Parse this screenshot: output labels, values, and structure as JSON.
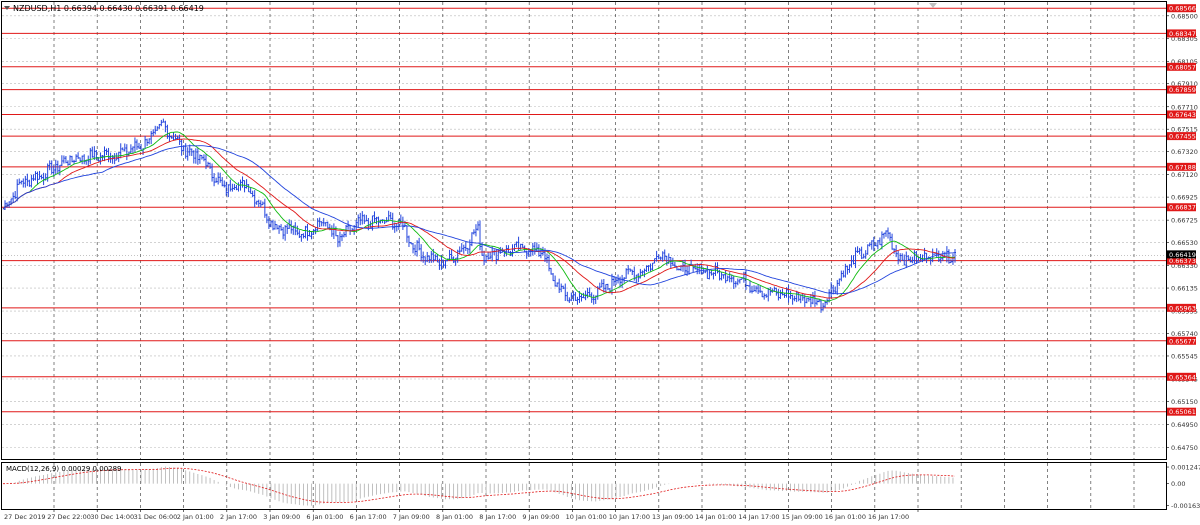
{
  "header": {
    "title": "NZDUSD,H1  0.66394 0.66430 0.66391 0.66419",
    "scroll_marker_icon": "triangle-down-icon"
  },
  "colors": {
    "candle": "#2244dd",
    "level_line": "#e01818",
    "level_label_bg": "#e01818",
    "ma_fast": "#11bb11",
    "ma_mid": "#e01818",
    "ma_slow": "#2244dd",
    "macd_hist": "#b0b0b0",
    "macd_signal": "#e01818",
    "grid": "#b8b8b8",
    "current_price_bg": "#000000"
  },
  "price_axis": {
    "ticks": [
      "0.68500",
      "0.68305",
      "0.68105",
      "0.67910",
      "0.67710",
      "0.67515",
      "0.67320",
      "0.67120",
      "0.66925",
      "0.66725",
      "0.66530",
      "0.66330",
      "0.66135",
      "0.65935",
      "0.65740",
      "0.65545",
      "0.65345",
      "0.65150",
      "0.64950",
      "0.64750"
    ],
    "levels": [
      "0.68566",
      "0.68347",
      "0.68057",
      "0.67859",
      "0.67643",
      "0.67455",
      "0.67188",
      "0.66837",
      "0.66373",
      "0.65963",
      "0.65677",
      "0.65364",
      "0.65061"
    ],
    "current_price": "0.66419"
  },
  "time_axis": {
    "labels": [
      "27 Dec 2019",
      "27 Dec 22:00",
      "30 Dec 14:00",
      "31 Dec 06:00",
      "2 Jan 01:00",
      "2 Jan 17:00",
      "3 Jan 09:00",
      "6 Jan 01:00",
      "6 Jan 17:00",
      "7 Jan 09:00",
      "8 Jan 01:00",
      "8 Jan 17:00",
      "9 Jan 09:00",
      "10 Jan 01:00",
      "10 Jan 17:00",
      "13 Jan 09:00",
      "14 Jan 01:00",
      "14 Jan 17:00",
      "15 Jan 09:00",
      "16 Jan 01:00",
      "16 Jan 17:00"
    ]
  },
  "macd": {
    "label": "MACD(12,26,9) 0.00029 0.00289",
    "ticks": [
      "0.001247",
      "0.00",
      "-0.001638"
    ]
  },
  "chart_data": {
    "type": "candlestick",
    "symbol": "NZDUSD",
    "timeframe": "H1",
    "ylim": [
      0.6465,
      0.6862
    ],
    "x": [
      "27 Dec 2019",
      "27 Dec 22:00",
      "30 Dec 14:00",
      "31 Dec 06:00",
      "2 Jan 01:00",
      "2 Jan 17:00",
      "3 Jan 09:00",
      "6 Jan 01:00",
      "6 Jan 17:00",
      "7 Jan 09:00",
      "8 Jan 01:00",
      "8 Jan 17:00",
      "9 Jan 09:00",
      "10 Jan 01:00",
      "10 Jan 17:00",
      "13 Jan 09:00",
      "14 Jan 01:00",
      "14 Jan 17:00",
      "15 Jan 09:00",
      "16 Jan 01:00",
      "16 Jan 17:00"
    ],
    "close_anchors": [
      [
        0,
        0.6682
      ],
      [
        18,
        0.6705
      ],
      [
        40,
        0.6712
      ],
      [
        65,
        0.6725
      ],
      [
        90,
        0.6728
      ],
      [
        115,
        0.673
      ],
      [
        140,
        0.6738
      ],
      [
        160,
        0.6755
      ],
      [
        170,
        0.6745
      ],
      [
        180,
        0.6735
      ],
      [
        200,
        0.6725
      ],
      [
        220,
        0.67
      ],
      [
        240,
        0.6705
      ],
      [
        255,
        0.669
      ],
      [
        270,
        0.6668
      ],
      [
        285,
        0.6665
      ],
      [
        300,
        0.666
      ],
      [
        320,
        0.6672
      ],
      [
        335,
        0.6655
      ],
      [
        355,
        0.667
      ],
      [
        380,
        0.6672
      ],
      [
        400,
        0.6668
      ],
      [
        410,
        0.665
      ],
      [
        425,
        0.664
      ],
      [
        440,
        0.6635
      ],
      [
        460,
        0.6648
      ],
      [
        475,
        0.6665
      ],
      [
        480,
        0.664
      ],
      [
        495,
        0.6645
      ],
      [
        520,
        0.6648
      ],
      [
        540,
        0.6645
      ],
      [
        550,
        0.662
      ],
      [
        565,
        0.6605
      ],
      [
        580,
        0.6605
      ],
      [
        600,
        0.6612
      ],
      [
        620,
        0.6625
      ],
      [
        640,
        0.6628
      ],
      [
        660,
        0.6645
      ],
      [
        675,
        0.663
      ],
      [
        690,
        0.663
      ],
      [
        720,
        0.6625
      ],
      [
        740,
        0.662
      ],
      [
        760,
        0.661
      ],
      [
        780,
        0.6608
      ],
      [
        800,
        0.6605
      ],
      [
        820,
        0.66
      ],
      [
        835,
        0.662
      ],
      [
        850,
        0.6638
      ],
      [
        870,
        0.665
      ],
      [
        885,
        0.6662
      ],
      [
        895,
        0.664
      ],
      [
        910,
        0.6638
      ],
      [
        930,
        0.6642
      ]
    ]
  }
}
